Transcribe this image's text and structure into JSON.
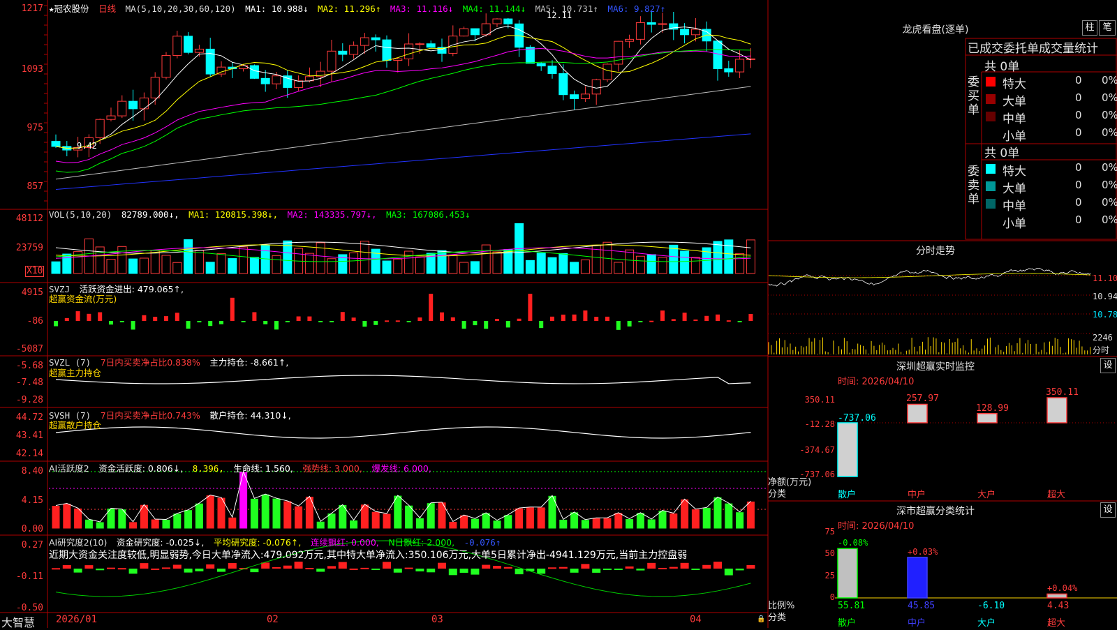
{
  "header": {
    "star": "★",
    "name": "冠农股份",
    "period": "日线",
    "ma_label": "MA(5,10,20,30,60,120)",
    "ma": [
      {
        "name": "MA1: 10.988↓",
        "color": "#ffffff"
      },
      {
        "name": "MA2: 11.296↑",
        "color": "#ffff00"
      },
      {
        "name": "MA3: 11.116↓",
        "color": "#ff00ff"
      },
      {
        "name": "MA4: 11.144↓",
        "color": "#00ff00"
      },
      {
        "name": "MA5: 10.731↑",
        "color": "#c0c0c0"
      },
      {
        "name": "MA6: 9.827↑",
        "color": "#0000ff"
      }
    ],
    "high_mark": "12.11",
    "low_mark": "9.42"
  },
  "price_axis": [
    "1217",
    "1093",
    "975",
    "857"
  ],
  "vol_panel": {
    "title": "VOL(5,10,20)",
    "value": "82789.000↓,",
    "ma1": "MA1: 120815.398↓,",
    "ma2": "MA2: 143335.797↓,",
    "ma3": "MA3: 167086.453↓",
    "axis": [
      "48112",
      "23759"
    ],
    "unit": "X10"
  },
  "svzj_panel": {
    "title": "SVZJ",
    "text": "活跃资金进出: 479.065↑,",
    "sub": "超赢资金流(万元)",
    "axis": [
      "4915",
      "-86",
      "-5087"
    ]
  },
  "svzl_panel": {
    "title": "SVZL (7)",
    "text1": "7日内买卖净占比0.838%",
    "text2": "主力持仓: -8.661↑,",
    "sub": "超赢主力持仓",
    "axis": [
      "-5.68",
      "-7.48",
      "-9.28"
    ]
  },
  "svsh_panel": {
    "title": "SVSH (7)",
    "text1": "7日内买卖净占比0.743%",
    "text2": "散户持仓: 44.310↓,",
    "sub": "超赢散户持仓",
    "axis": [
      "44.72",
      "43.41",
      "42.14"
    ]
  },
  "ai_active": {
    "title": "AI活跃度2",
    "t1": "资金活跃度: 0.806↓,",
    "t2": "8.396,",
    "t3": "生命线: 1.560,",
    "t4": "强势线: 3.000,",
    "t5": "爆发线: 6.000,",
    "axis": [
      "8.40",
      "4.15",
      "0.00"
    ]
  },
  "ai_research": {
    "title": "AI研究度2(10)",
    "t1": "资金研究度: -0.025↓,",
    "t2": "平均研究度: -0.076↑,",
    "t3": "连续飘红: 0.000,",
    "t4": "N日飘红: 2.000,",
    "t5": "-0.076↑",
    "commentary": "近期大资金关注度较低,明显弱势,今日大单净流入:479.092万元,其中特大单净流入:350.106万元,大单5日累计净出-4941.129万元,当前主力控盘弱",
    "axis": [
      "0.27",
      "-0.11",
      "-0.50"
    ]
  },
  "footer": {
    "brand": "大智慧",
    "dates": [
      "2026/01",
      "02",
      "03",
      "04"
    ]
  },
  "longhu": {
    "title": "龙虎看盘(逐单)",
    "btn1": "柱",
    "btn2": "笔",
    "tabs": "已成交委托单成交量统计",
    "buy_total": "共 0单",
    "buy_label": "委买单",
    "sell_total": "共 0单",
    "sell_label": "委卖单",
    "buy_rows": [
      {
        "name": "特大",
        "count": "0",
        "pct": "0%",
        "color": "#ff0000"
      },
      {
        "name": "大单",
        "count": "0",
        "pct": "0%",
        "color": "#990000"
      },
      {
        "name": "中单",
        "count": "0",
        "pct": "0%",
        "color": "#660000"
      },
      {
        "name": "小单",
        "count": "0",
        "pct": "0%",
        "color": "#000000"
      }
    ],
    "sell_rows": [
      {
        "name": "特大",
        "count": "0",
        "pct": "0%",
        "color": "#00ffff"
      },
      {
        "name": "大单",
        "count": "0",
        "pct": "0%",
        "color": "#009999"
      },
      {
        "name": "中单",
        "count": "0",
        "pct": "0%",
        "color": "#006666"
      },
      {
        "name": "小单",
        "count": "0",
        "pct": "0%",
        "color": "#000000"
      }
    ]
  },
  "intraday": {
    "title": "分时走势",
    "axis": [
      "11.10",
      "10.94",
      "10.78"
    ],
    "vol_axis": "2246",
    "vol_unit": "分时"
  },
  "sz_monitor": {
    "title": "深圳超赢实时监控",
    "btn": "设",
    "time": "时间: 2026/04/10",
    "axis": [
      "350.11",
      "-12.28",
      "-374.67",
      "-737.06"
    ],
    "ylabel": "净额(万元)",
    "xlabel": "分类",
    "categories": [
      "散户",
      "中户",
      "大户",
      "超大"
    ],
    "values": [
      -737.06,
      257.97,
      128.99,
      350.11
    ],
    "value_labels": [
      "-737.06",
      "257.97",
      "128.99",
      "350.11"
    ]
  },
  "sz_class": {
    "title": "深市超赢分类统计",
    "btn": "设",
    "time": "时间: 2026/04/10",
    "axis": [
      "75",
      "50",
      "25",
      "0"
    ],
    "ylabel": "比例%",
    "xlabel": "分类",
    "categories": [
      "散户",
      "中户",
      "大户",
      "超大"
    ],
    "values": [
      55.81,
      45.85,
      -6.1,
      4.43
    ],
    "value_labels": [
      "55.81",
      "45.85",
      "-6.10",
      "4.43"
    ],
    "change_labels": [
      "-0.08%",
      "+0.03%",
      "",
      "+0.04%"
    ]
  },
  "chart_data": {
    "type": "candlestick",
    "series": [
      {
        "name": "MA1",
        "values": []
      },
      {
        "name": "MA2",
        "values": []
      }
    ]
  }
}
